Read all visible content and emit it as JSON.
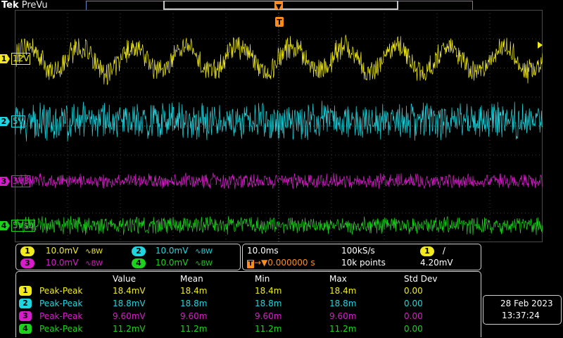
{
  "brand": {
    "logo": "Tek",
    "mode": "PreVu"
  },
  "trigger_marker": "T",
  "channels": [
    {
      "num": "1",
      "label": "12V",
      "color": "#f2ea1e",
      "scale": "10.0mV",
      "bw": "∿BW"
    },
    {
      "num": "2",
      "label": "5V",
      "color": "#1ed6e0",
      "scale": "10.0mV",
      "bw": "∿BW"
    },
    {
      "num": "3",
      "label": "3V3",
      "color": "#d81ccc",
      "scale": "10.0mV",
      "bw": "∿BW"
    },
    {
      "num": "4",
      "label": "5Vsb",
      "color": "#1cd21c",
      "scale": "10.0mV",
      "bw": "∿BW"
    }
  ],
  "horizontal": {
    "time_div": "10.0ms",
    "sample_rate": "100kS/s",
    "trigger_pos": "0.000000 s",
    "record_length": "10k points",
    "trigger_source": "1",
    "trigger_slope": "/",
    "trigger_level": "4.20mV"
  },
  "measurements": {
    "headers": [
      "Value",
      "Mean",
      "Min",
      "Max",
      "Std Dev"
    ],
    "rows": [
      {
        "num": "1",
        "name": "Peak-Peak",
        "value": "18.4mV",
        "mean": "18.4m",
        "min": "18.4m",
        "max": "18.4m",
        "std": "0.00"
      },
      {
        "num": "2",
        "name": "Peak-Peak",
        "value": "18.8mV",
        "mean": "18.8m",
        "min": "18.8m",
        "max": "18.8m",
        "std": "0.00"
      },
      {
        "num": "3",
        "name": "Peak-Peak",
        "value": "9.60mV",
        "mean": "9.60m",
        "min": "9.60m",
        "max": "9.60m",
        "std": "0.00"
      },
      {
        "num": "4",
        "name": "Peak-Peak",
        "value": "11.2mV",
        "mean": "11.2m",
        "min": "11.2m",
        "max": "11.2m",
        "std": "0.00"
      }
    ]
  },
  "datetime": {
    "date": "28 Feb  2023",
    "time": "13:37:24"
  },
  "chart_data": {
    "type": "line",
    "series": [
      {
        "name": "12V",
        "color": "#f2ea1e"
      },
      {
        "name": "5V",
        "color": "#1ed6e0"
      },
      {
        "name": "3V3",
        "color": "#d81ccc"
      },
      {
        "name": "5Vsb",
        "color": "#1cd21c"
      }
    ],
    "grid": true
  }
}
